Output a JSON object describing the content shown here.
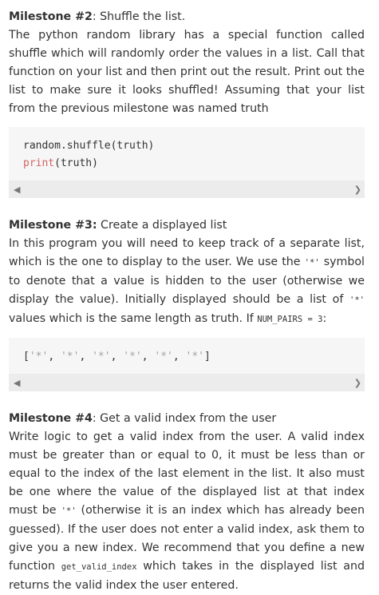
{
  "m2": {
    "title": "Milestone #2",
    "subtitle": ": Shuffle the list.",
    "body": "The python random library has a special function called shuffle which will randomly order the values in a list. Call that function on your list and then print out the result. Print out the list to make sure it looks shuffled! Assuming that your list from the previous milestone was named truth",
    "code_line1": "random.shuffle(truth)",
    "code_kw": "print",
    "code_rest": "(truth)"
  },
  "m3": {
    "title": "Milestone #3:",
    "subtitle": " Create a displayed list",
    "body_a": "In this program you will need to keep track of a separate list, which is the one to display to the user. We use the ",
    "star": "'*'",
    "body_b": " symbol to denote that a value is hidden to the user (otherwise we display the value). Initially displayed should be a list of ",
    "body_c": " values which is the same length as truth. If ",
    "num_pairs": "NUM_PAIRS = 3",
    "body_d": ":",
    "code_open": "[",
    "code_items": [
      "'*'",
      "'*'",
      "'*'",
      "'*'",
      "'*'",
      "'*'"
    ],
    "code_close": "]"
  },
  "m4": {
    "title": "Milestone #4",
    "subtitle": ": Get a valid index from the user",
    "body_a": "Write logic to get a valid index from the user. A valid index must be greater than or equal to 0, it must be less than or equal to the index of the last element in the list. It also must be one where the value of the displayed list at that index must be ",
    "star": "'*'",
    "body_b": " (otherwise it is an index which has already been guessed). If the user does not enter a valid index, ask them to give you a new index. We recommend that you define a new function ",
    "fn": "get_valid_index",
    "body_c": " which takes in the displayed list and returns the valid index the user entered."
  },
  "icons": {
    "left": "chevron-left-icon",
    "right": "chevron-right-icon"
  },
  "colors": {
    "keyword": "#d26464",
    "string": "#a2a2a2",
    "codebg": "#f6f6f6",
    "scrollbar": "#ececec"
  }
}
